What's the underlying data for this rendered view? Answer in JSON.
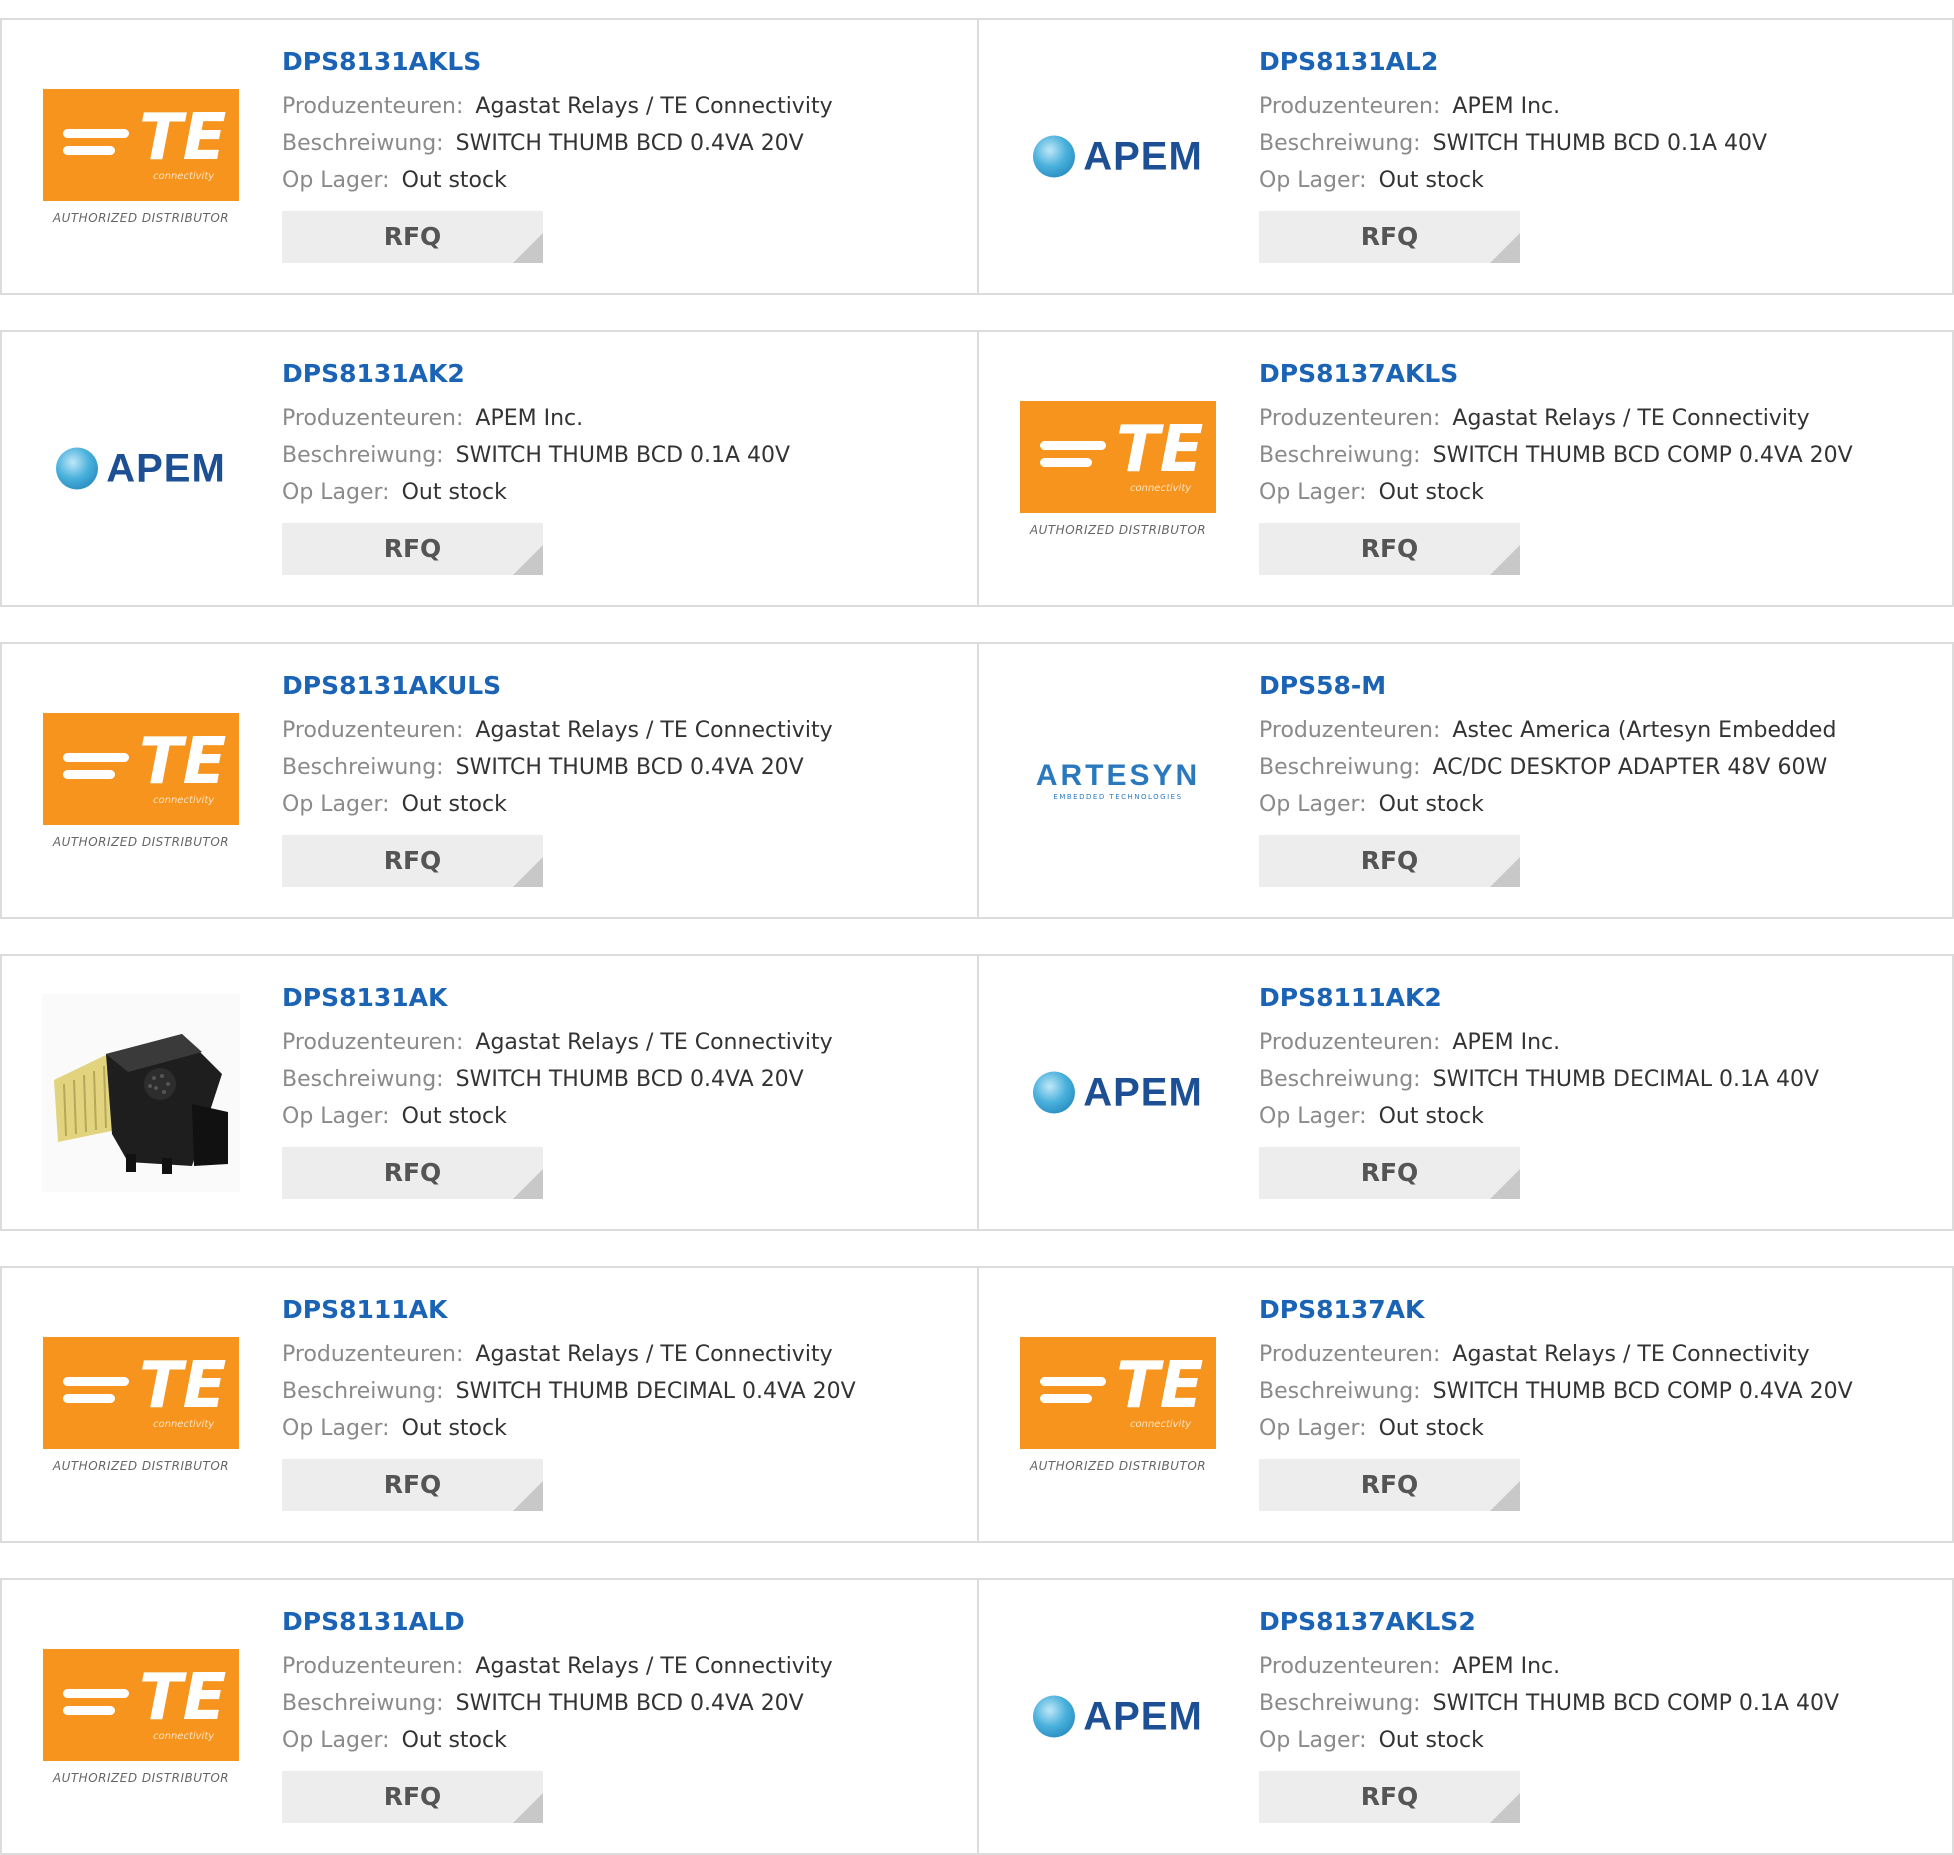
{
  "labels": {
    "manufacturer": "Produzenteuren:",
    "description": "Beschreiwung:",
    "stock": "Op Lager:",
    "rfq": "RFQ"
  },
  "logos": {
    "te_text": "TE",
    "te_sub": "connectivity",
    "te_authorized": "AUTHORIZED DISTRIBUTOR",
    "apem_text": "APEM",
    "artesyn_text": "ARTESYN",
    "artesyn_sub": "EMBEDDED TECHNOLOGIES"
  },
  "colors": {
    "part_link": "#1a63b5",
    "te_orange": "#f7941d",
    "rfq_bg": "#ededed"
  },
  "products": [
    {
      "part": "DPS8131AKLS",
      "logo": "te",
      "manufacturer": "Agastat Relays / TE Connectivity",
      "description": "SWITCH THUMB BCD 0.4VA 20V",
      "stock": "Out stock"
    },
    {
      "part": "DPS8131AL2",
      "logo": "apem",
      "manufacturer": "APEM Inc.",
      "description": "SWITCH THUMB BCD 0.1A 40V",
      "stock": "Out stock"
    },
    {
      "part": "DPS8131AK2",
      "logo": "apem",
      "manufacturer": "APEM Inc.",
      "description": "SWITCH THUMB BCD 0.1A 40V",
      "stock": "Out stock"
    },
    {
      "part": "DPS8137AKLS",
      "logo": "te",
      "manufacturer": "Agastat Relays / TE Connectivity",
      "description": "SWITCH THUMB BCD COMP 0.4VA 20V",
      "stock": "Out stock"
    },
    {
      "part": "DPS8131AKULS",
      "logo": "te",
      "manufacturer": "Agastat Relays / TE Connectivity",
      "description": "SWITCH THUMB BCD 0.4VA 20V",
      "stock": "Out stock"
    },
    {
      "part": "DPS58-M",
      "logo": "artesyn",
      "manufacturer": "Astec America (Artesyn Embedded",
      "description": "AC/DC DESKTOP ADAPTER 48V 60W",
      "stock": "Out stock"
    },
    {
      "part": "DPS8131AK",
      "logo": "photo",
      "manufacturer": "Agastat Relays / TE Connectivity",
      "description": "SWITCH THUMB BCD 0.4VA 20V",
      "stock": "Out stock"
    },
    {
      "part": "DPS8111AK2",
      "logo": "apem",
      "manufacturer": "APEM Inc.",
      "description": "SWITCH THUMB DECIMAL 0.1A 40V",
      "stock": "Out stock"
    },
    {
      "part": "DPS8111AK",
      "logo": "te",
      "manufacturer": "Agastat Relays / TE Connectivity",
      "description": "SWITCH THUMB DECIMAL 0.4VA 20V",
      "stock": "Out stock"
    },
    {
      "part": "DPS8137AK",
      "logo": "te",
      "manufacturer": "Agastat Relays / TE Connectivity",
      "description": "SWITCH THUMB BCD COMP 0.4VA 20V",
      "stock": "Out stock"
    },
    {
      "part": "DPS8131ALD",
      "logo": "te",
      "manufacturer": "Agastat Relays / TE Connectivity",
      "description": "SWITCH THUMB BCD 0.4VA 20V",
      "stock": "Out stock"
    },
    {
      "part": "DPS8137AKLS2",
      "logo": "apem",
      "manufacturer": "APEM Inc.",
      "description": "SWITCH THUMB BCD COMP 0.1A 40V",
      "stock": "Out stock"
    }
  ]
}
